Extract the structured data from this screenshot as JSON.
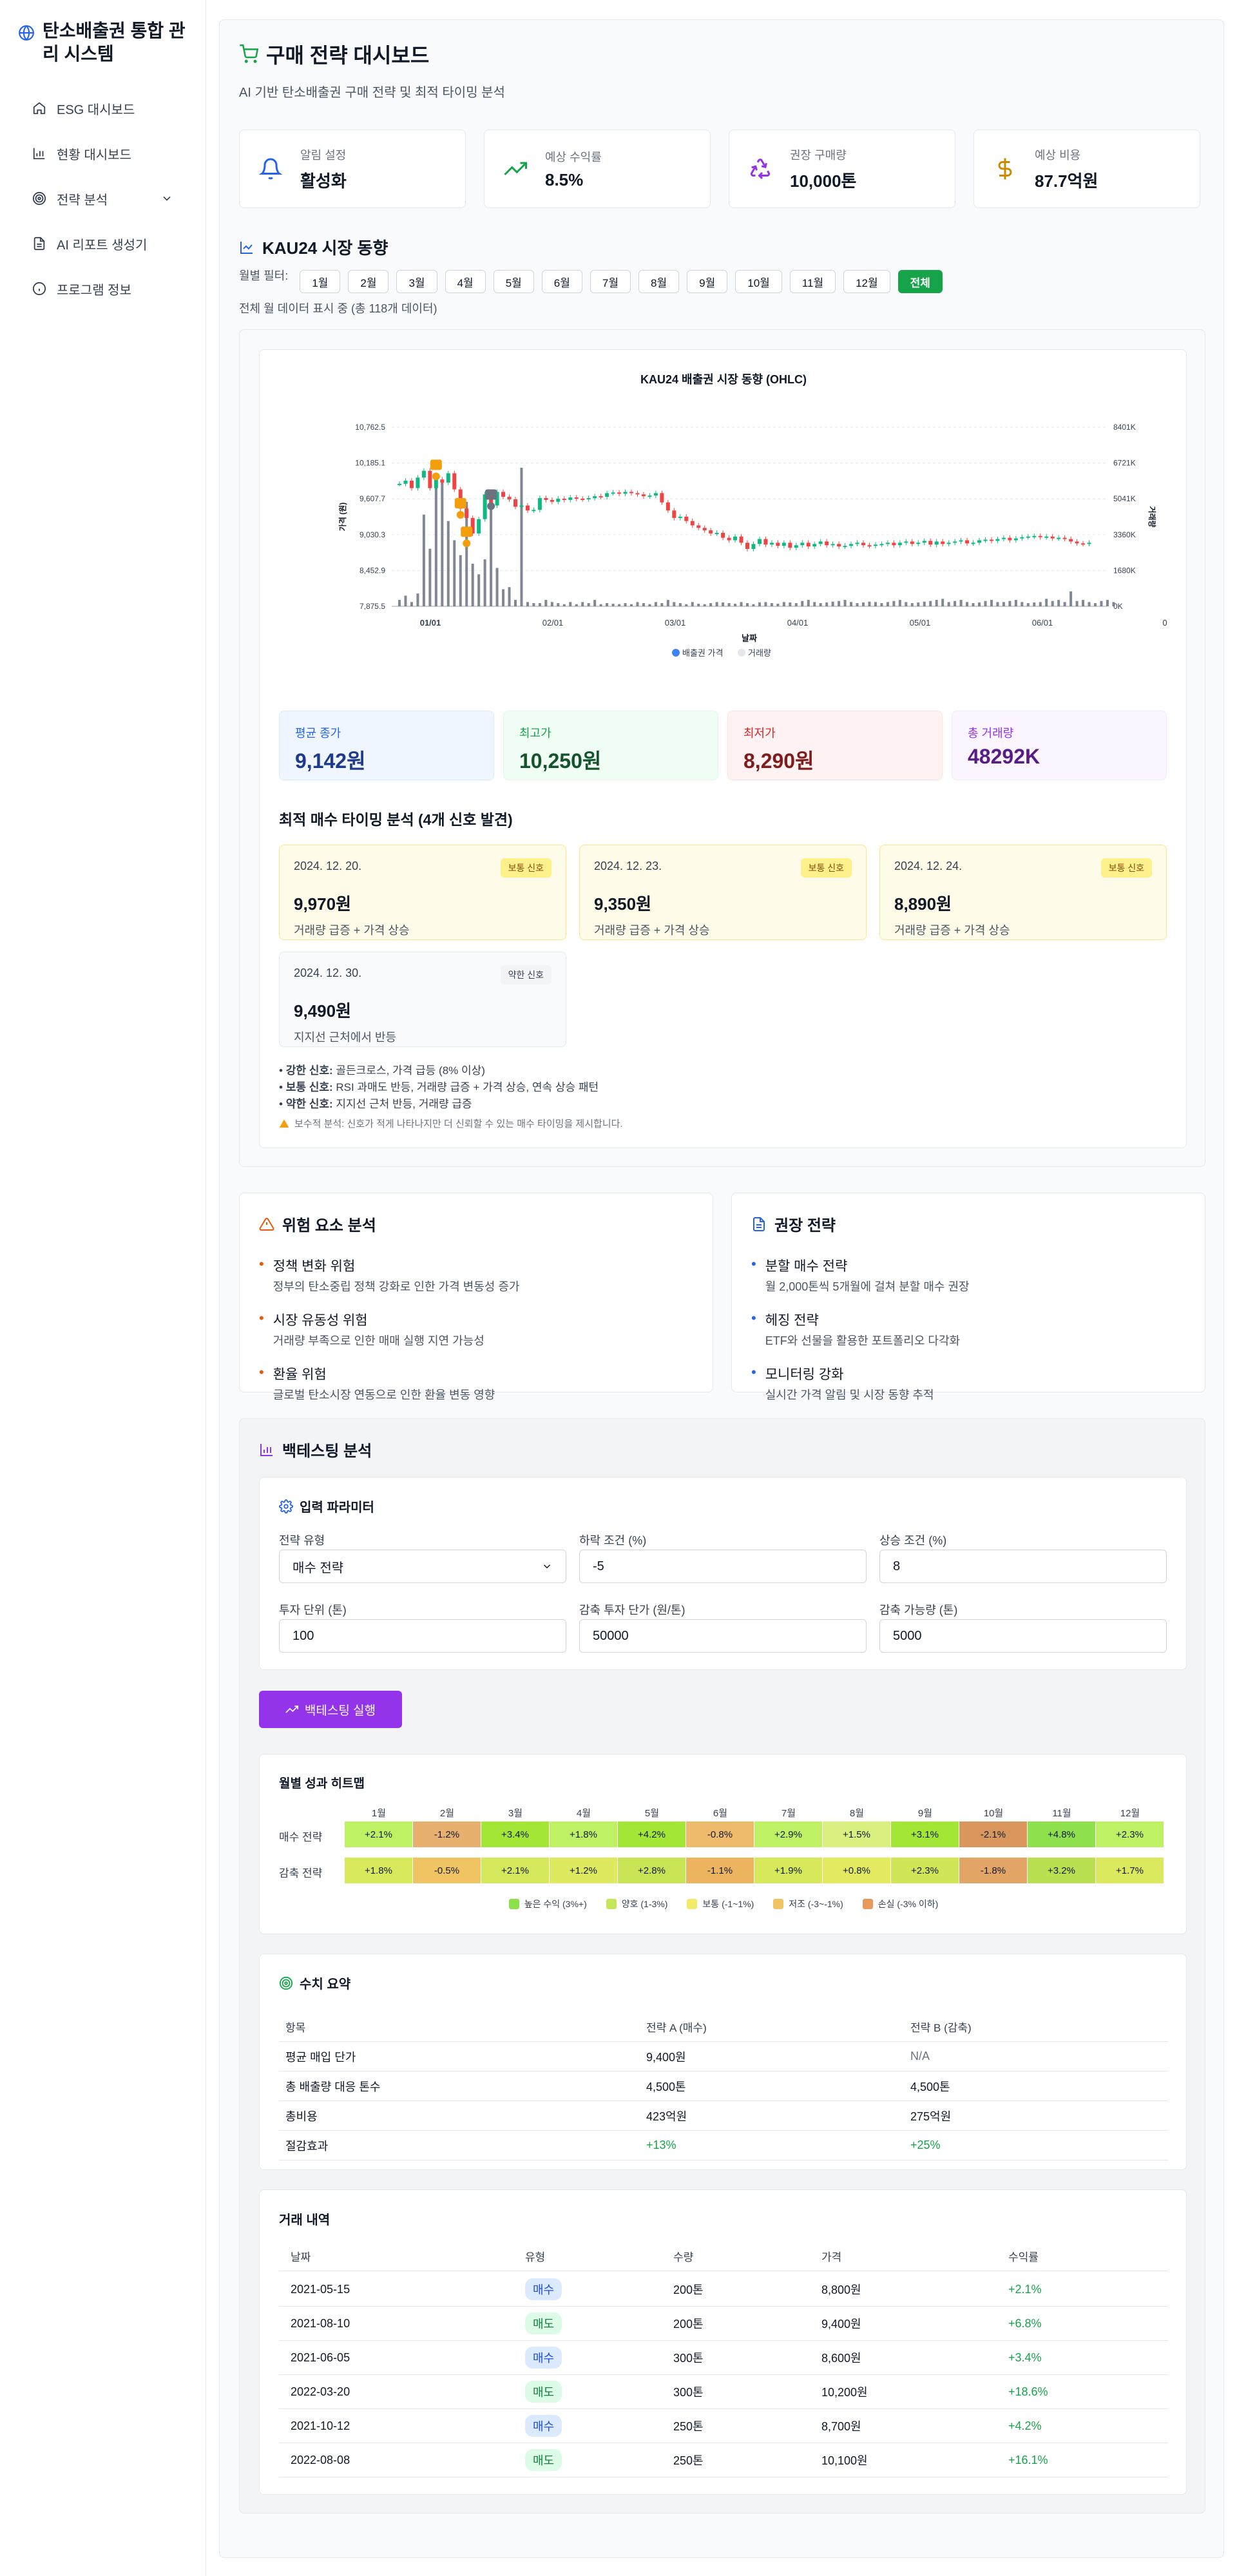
{
  "app": {
    "title": "탄소배출권 통합 관리 시스템"
  },
  "sidebar": {
    "items": [
      {
        "label": "ESG 대시보드",
        "icon": "home-icon"
      },
      {
        "label": "현황 대시보드",
        "icon": "bar-chart-icon"
      },
      {
        "label": "전략 분석",
        "icon": "target-icon"
      },
      {
        "label": "AI 리포트 생성기",
        "icon": "document-icon"
      },
      {
        "label": "프로그램 정보",
        "icon": "info-icon"
      }
    ]
  },
  "page": {
    "title": "구매 전략 대시보드",
    "subtitle": "AI 기반 탄소배출권 구매 전략 및 최적 타이밍 분석"
  },
  "kpis": [
    {
      "label": "알림 설정",
      "value": "활성화",
      "icon": "bell-icon",
      "color": "#2563eb"
    },
    {
      "label": "예상 수익률",
      "value": "8.5%",
      "icon": "trending-up-icon",
      "color": "#16a34a"
    },
    {
      "label": "권장 구매량",
      "value": "10,000톤",
      "icon": "recycle-icon",
      "color": "#9333ea"
    },
    {
      "label": "예상 비용",
      "value": "87.7억원",
      "icon": "dollar-icon",
      "color": "#ca8a04"
    }
  ],
  "market": {
    "title": "KAU24 시장 동향",
    "filter_label": "월별 필터:",
    "months": [
      "1월",
      "2월",
      "3월",
      "4월",
      "5월",
      "6월",
      "7월",
      "8월",
      "9월",
      "10월",
      "11월",
      "12월",
      "전체"
    ],
    "active_month": "전체",
    "filter_status": "전체 월 데이터 표시 중 (총 118개 데이터)"
  },
  "chart_data": {
    "type": "candlestick",
    "title": "KAU24 배출권 시장 동향 (OHLC)",
    "xlabel": "날짜",
    "ylabel_left": "가격 (원)",
    "ylabel_right": "거래량",
    "y_ticks": [
      "10,762.5",
      "10,185.1",
      "9,607.7",
      "9,030.3",
      "8,452.9",
      "7,875.5"
    ],
    "y2_ticks": [
      "8401K",
      "6721K",
      "5041K",
      "3360K",
      "1680K",
      "0K"
    ],
    "x_ticks": [
      "01/01",
      "02/01",
      "03/01",
      "04/01",
      "05/01",
      "06/01",
      "0"
    ],
    "ylim": [
      7875.5,
      10762.5
    ],
    "y2lim": [
      0,
      8401
    ],
    "legend": [
      "배출권 가격",
      "거래량"
    ],
    "series_prices": [
      9850,
      9900,
      9780,
      9950,
      10060,
      9780,
      9920,
      9870,
      10020,
      9760,
      9450,
      9300,
      9050,
      9280,
      9680,
      9500,
      9720,
      9640,
      9600,
      9480,
      9500,
      9420,
      9430,
      9620,
      9590,
      9560,
      9610,
      9590,
      9630,
      9610,
      9600,
      9620,
      9650,
      9640,
      9700,
      9710,
      9690,
      9720,
      9700,
      9680,
      9650,
      9660,
      9700,
      9550,
      9420,
      9300,
      9320,
      9250,
      9180,
      9140,
      9100,
      9050,
      9060,
      8980,
      8940,
      9000,
      8900,
      8800,
      8880,
      8960,
      8870,
      8900,
      8850,
      8900,
      8820,
      8860,
      8900,
      8840,
      8880,
      8920,
      8860,
      8880,
      8840,
      8850,
      8880,
      8900,
      8860,
      8850,
      8870,
      8880,
      8900,
      8860,
      8900,
      8920,
      8880,
      8900,
      8930,
      8870,
      8920,
      8880,
      8900,
      8920,
      8940,
      8890,
      8900,
      8940,
      8950,
      8930,
      8960,
      8980,
      8940,
      8970,
      8990,
      9000,
      9010,
      8990,
      9000,
      8970,
      8980,
      8960,
      8920,
      8890,
      8880,
      8900
    ],
    "volumes_k": [
      300,
      500,
      200,
      600,
      4300,
      2700,
      6200,
      5800,
      4000,
      3100,
      2400,
      4900,
      2000,
      1500,
      2200,
      5200,
      1800,
      800,
      900,
      300,
      6500,
      200,
      150,
      150,
      300,
      200,
      150,
      100,
      200,
      100,
      200,
      150,
      300,
      100,
      150,
      120,
      100,
      150,
      100,
      200,
      150,
      100,
      200,
      150,
      300,
      200,
      150,
      100,
      200,
      120,
      100,
      150,
      200,
      180,
      150,
      120,
      200,
      150,
      100,
      180,
      200,
      150,
      120,
      200,
      180,
      150,
      250,
      300,
      200,
      150,
      180,
      220,
      250,
      300,
      200,
      150,
      180,
      220,
      200,
      150,
      200,
      250,
      300,
      200,
      150,
      180,
      220,
      250,
      300,
      350,
      200,
      250,
      300,
      200,
      150,
      180,
      250,
      300,
      200,
      200,
      250,
      300,
      200,
      150,
      180,
      200,
      350,
      250,
      300,
      200,
      700,
      250,
      300,
      200,
      150,
      250,
      300,
      200
    ],
    "signals": [
      {
        "idx": 6,
        "price": 9970,
        "type": "보통"
      },
      {
        "idx": 10,
        "price": 9350,
        "type": "보통"
      },
      {
        "idx": 11,
        "price": 8890,
        "type": "보통"
      },
      {
        "idx": 15,
        "price": 9490,
        "type": "약한"
      }
    ]
  },
  "stats": [
    {
      "label": "평균 종가",
      "value": "9,142원"
    },
    {
      "label": "최고가",
      "value": "10,250원"
    },
    {
      "label": "최저가",
      "value": "8,290원"
    },
    {
      "label": "총 거래량",
      "value": "48292K"
    }
  ],
  "timing": {
    "title": "최적 매수 타이밍 분석 (4개 신호 발견)",
    "signals": [
      {
        "date": "2024. 12. 20.",
        "badge": "보통 신호",
        "price": "9,970원",
        "reason": "거래량 급증 + 가격 상승"
      },
      {
        "date": "2024. 12. 23.",
        "badge": "보통 신호",
        "price": "9,350원",
        "reason": "거래량 급증 + 가격 상승"
      },
      {
        "date": "2024. 12. 24.",
        "badge": "보통 신호",
        "price": "8,890원",
        "reason": "거래량 급증 + 가격 상승"
      },
      {
        "date": "2024. 12. 30.",
        "badge": "약한 신호",
        "price": "9,490원",
        "reason": "지지선 근처에서 반등"
      }
    ],
    "legend": [
      {
        "k": "강한 신호:",
        "v": "골든크로스, 가격 급등 (8% 이상)"
      },
      {
        "k": "보통 신호:",
        "v": "RSI 과매도 반등, 거래량 급증 + 가격 상승, 연속 상승 패턴"
      },
      {
        "k": "약한 신호:",
        "v": "지지선 근처 반등, 거래량 급증"
      }
    ],
    "note": "보수적 분석: 신호가 적게 나타나지만 더 신뢰할 수 있는 매수 타이밍을 제시합니다."
  },
  "risk": {
    "title": "위험 요소 분석",
    "items": [
      {
        "t": "정책 변화 위험",
        "s": "정부의 탄소중립 정책 강화로 인한 가격 변동성 증가"
      },
      {
        "t": "시장 유동성 위험",
        "s": "거래량 부족으로 인한 매매 실행 지연 가능성"
      },
      {
        "t": "환율 위험",
        "s": "글로벌 탄소시장 연동으로 인한 환율 변동 영향"
      }
    ]
  },
  "strategy": {
    "title": "권장 전략",
    "items": [
      {
        "t": "분할 매수 전략",
        "s": "월 2,000톤씩 5개월에 걸쳐 분할 매수 권장"
      },
      {
        "t": "헤징 전략",
        "s": "ETF와 선물을 활용한 포트폴리오 다각화"
      },
      {
        "t": "모니터링 강화",
        "s": "실시간 가격 알림 및 시장 동향 추적"
      }
    ]
  },
  "backtest": {
    "title": "백테스팅 분석",
    "params_title": "입력 파라미터",
    "fields": {
      "strategy_type": {
        "label": "전략 유형",
        "value": "매수 전략"
      },
      "drop": {
        "label": "하락 조건 (%)",
        "value": "-5"
      },
      "rise": {
        "label": "상승 조건 (%)",
        "value": "8"
      },
      "unit": {
        "label": "투자 단위 (톤)",
        "value": "100"
      },
      "reduction_cost": {
        "label": "감축 투자 단가 (원/톤)",
        "value": "50000"
      },
      "reduction_capacity": {
        "label": "감축 가능량 (톤)",
        "value": "5000"
      }
    },
    "run_label": "백테스팅 실행",
    "heatmap": {
      "title": "월별 성과 히트맵",
      "months": [
        "1월",
        "2월",
        "3월",
        "4월",
        "5월",
        "6월",
        "7월",
        "8월",
        "9월",
        "10월",
        "11월",
        "12월"
      ],
      "rows": [
        {
          "name": "매수 전략",
          "values": [
            "+2.1%",
            "-1.2%",
            "+3.4%",
            "+1.8%",
            "+4.2%",
            "-0.8%",
            "+2.9%",
            "+1.5%",
            "+3.1%",
            "-2.1%",
            "+4.8%",
            "+2.3%"
          ],
          "colors": [
            "#bef264",
            "#e8b06e",
            "#a3e635",
            "#bef264",
            "#a3e635",
            "#eebb6c",
            "#bef264",
            "#d9ef80",
            "#a3e635",
            "#d9975e",
            "#8ee04c",
            "#bef264"
          ]
        },
        {
          "name": "감축 전략",
          "values": [
            "+1.8%",
            "-0.5%",
            "+2.1%",
            "+1.2%",
            "+2.8%",
            "-1.1%",
            "+1.9%",
            "+0.8%",
            "+2.3%",
            "-1.8%",
            "+3.2%",
            "+1.7%"
          ],
          "colors": [
            "#d9e95c",
            "#f0c463",
            "#d5e75a",
            "#dde95f",
            "#c8e455",
            "#edb45f",
            "#d7e85b",
            "#e3ea60",
            "#d0e657",
            "#e2a566",
            "#b9e050",
            "#dae95d"
          ]
        }
      ],
      "legend": [
        {
          "label": "높은 수익 (3%+)",
          "color": "#8ee04c"
        },
        {
          "label": "양호 (1-3%)",
          "color": "#c6e65a"
        },
        {
          "label": "보통 (-1~1%)",
          "color": "#f3ea6a"
        },
        {
          "label": "저조 (-3~-1%)",
          "color": "#f0c463"
        },
        {
          "label": "손실 (-3% 이하)",
          "color": "#e89a5d"
        }
      ]
    },
    "summary": {
      "title": "수치 요약",
      "headers": [
        "항목",
        "전략 A (매수)",
        "전략 B (감축)"
      ],
      "rows": [
        [
          "평균 매입 단가",
          "9,400원",
          "N/A"
        ],
        [
          "총 배출량 대응 톤수",
          "4,500톤",
          "4,500톤"
        ],
        [
          "총비용",
          "423억원",
          "275억원"
        ],
        [
          "절감효과",
          "+13%",
          "+25%"
        ]
      ]
    },
    "trades": {
      "title": "거래 내역",
      "headers": [
        "날짜",
        "유형",
        "수량",
        "가격",
        "수익률"
      ],
      "rows": [
        {
          "date": "2021-05-15",
          "type": "매수",
          "qty": "200톤",
          "price": "8,800원",
          "ret": "+2.1%"
        },
        {
          "date": "2021-08-10",
          "type": "매도",
          "qty": "200톤",
          "price": "9,400원",
          "ret": "+6.8%"
        },
        {
          "date": "2021-06-05",
          "type": "매수",
          "qty": "300톤",
          "price": "8,600원",
          "ret": "+3.4%"
        },
        {
          "date": "2022-03-20",
          "type": "매도",
          "qty": "300톤",
          "price": "10,200원",
          "ret": "+18.6%"
        },
        {
          "date": "2021-10-12",
          "type": "매수",
          "qty": "250톤",
          "price": "8,700원",
          "ret": "+4.2%"
        },
        {
          "date": "2022-08-08",
          "type": "매도",
          "qty": "250톤",
          "price": "10,100원",
          "ret": "+16.1%"
        }
      ]
    }
  }
}
